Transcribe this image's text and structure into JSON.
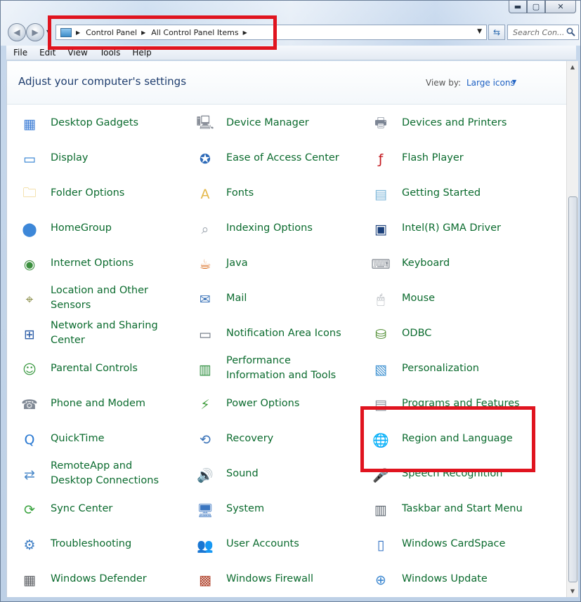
{
  "window": {
    "caption_buttons": [
      "minimize-icon",
      "maximize-icon",
      "close-icon"
    ]
  },
  "nav": {
    "address_path": [
      "Control Panel",
      "All Control Panel Items"
    ],
    "search_placeholder": "Search Con..."
  },
  "menu": [
    "File",
    "Edit",
    "View",
    "Tools",
    "Help"
  ],
  "header": {
    "title": "Adjust your computer's settings",
    "view_by_label": "View by:",
    "view_by_value": "Large icons"
  },
  "items": [
    {
      "label": "Desktop Gadgets",
      "icon": "desktop-gadgets-icon",
      "color": "#3a7bd5",
      "glyph": "▦"
    },
    {
      "label": "Device Manager",
      "icon": "device-manager-icon",
      "color": "#8a8f99",
      "glyph": "🖳"
    },
    {
      "label": "Devices and Printers",
      "icon": "devices-printers-icon",
      "color": "#7c8594",
      "glyph": "🖶"
    },
    {
      "label": "Display",
      "icon": "display-icon",
      "color": "#2f7fd1",
      "glyph": "▭"
    },
    {
      "label": "Ease of Access Center",
      "icon": "ease-of-access-icon",
      "color": "#2d6ab8",
      "glyph": "✪"
    },
    {
      "label": "Flash Player",
      "icon": "flash-player-icon",
      "color": "#c3161c",
      "glyph": "ƒ"
    },
    {
      "label": "Folder Options",
      "icon": "folder-options-icon",
      "color": "#e7c155",
      "glyph": "🗀"
    },
    {
      "label": "Fonts",
      "icon": "fonts-icon",
      "color": "#e4b84a",
      "glyph": "A"
    },
    {
      "label": "Getting Started",
      "icon": "getting-started-icon",
      "color": "#7cb6d8",
      "glyph": "▤"
    },
    {
      "label": "HomeGroup",
      "icon": "homegroup-icon",
      "color": "#3d87d8",
      "glyph": "⬤"
    },
    {
      "label": "Indexing Options",
      "icon": "indexing-options-icon",
      "color": "#9aa3ad",
      "glyph": "⌕"
    },
    {
      "label": "Intel(R) GMA Driver",
      "icon": "intel-gma-icon",
      "color": "#1a3f7a",
      "glyph": "▣"
    },
    {
      "label": "Internet Options",
      "icon": "internet-options-icon",
      "color": "#3b8f3e",
      "glyph": "◉"
    },
    {
      "label": "Java",
      "icon": "java-icon",
      "color": "#d86a1b",
      "glyph": "☕"
    },
    {
      "label": "Keyboard",
      "icon": "keyboard-icon",
      "color": "#8d939b",
      "glyph": "⌨"
    },
    {
      "label": "Location and Other Sensors",
      "icon": "location-sensors-icon",
      "color": "#8b8f4a",
      "glyph": "⌖"
    },
    {
      "label": "Mail",
      "icon": "mail-icon",
      "color": "#3a73b8",
      "glyph": "✉"
    },
    {
      "label": "Mouse",
      "icon": "mouse-icon",
      "color": "#a7acb3",
      "glyph": "🖱"
    },
    {
      "label": "Network and Sharing Center",
      "icon": "network-sharing-icon",
      "color": "#2f5fa8",
      "glyph": "⊞"
    },
    {
      "label": "Notification Area Icons",
      "icon": "notification-area-icon",
      "color": "#6b7480",
      "glyph": "▭"
    },
    {
      "label": "ODBC",
      "icon": "odbc-icon",
      "color": "#4c8b2e",
      "glyph": "⛁"
    },
    {
      "label": "Parental Controls",
      "icon": "parental-controls-icon",
      "color": "#3d9a44",
      "glyph": "☺"
    },
    {
      "label": "Performance Information and Tools",
      "icon": "performance-icon",
      "color": "#2b8d3c",
      "glyph": "▥"
    },
    {
      "label": "Personalization",
      "icon": "personalization-icon",
      "color": "#3a8fd0",
      "glyph": "▧"
    },
    {
      "label": "Phone and Modem",
      "icon": "phone-modem-icon",
      "color": "#7f8894",
      "glyph": "☎"
    },
    {
      "label": "Power Options",
      "icon": "power-options-icon",
      "color": "#3d9b3a",
      "glyph": "⚡"
    },
    {
      "label": "Programs and Features",
      "icon": "programs-features-icon",
      "color": "#8a8f99",
      "glyph": "▤"
    },
    {
      "label": "QuickTime",
      "icon": "quicktime-icon",
      "color": "#2a79d2",
      "glyph": "Q"
    },
    {
      "label": "Recovery",
      "icon": "recovery-icon",
      "color": "#3a73b8",
      "glyph": "⟲"
    },
    {
      "label": "Region and Language",
      "icon": "region-language-icon",
      "color": "#2e8fd6",
      "glyph": "🌐"
    },
    {
      "label": "RemoteApp and Desktop Connections",
      "icon": "remoteapp-icon",
      "color": "#4b89c9",
      "glyph": "⇄"
    },
    {
      "label": "Sound",
      "icon": "sound-icon",
      "color": "#9ba3ad",
      "glyph": "🔊"
    },
    {
      "label": "Speech Recognition",
      "icon": "speech-recognition-icon",
      "color": "#a8aeb6",
      "glyph": "🎤"
    },
    {
      "label": "Sync Center",
      "icon": "sync-center-icon",
      "color": "#3aa33f",
      "glyph": "⟳"
    },
    {
      "label": "System",
      "icon": "system-icon",
      "color": "#3b76c0",
      "glyph": "🖥"
    },
    {
      "label": "Taskbar and Start Menu",
      "icon": "taskbar-start-icon",
      "color": "#5d6670",
      "glyph": "▥"
    },
    {
      "label": "Troubleshooting",
      "icon": "troubleshooting-icon",
      "color": "#3d7dc4",
      "glyph": "⚙"
    },
    {
      "label": "User Accounts",
      "icon": "user-accounts-icon",
      "color": "#d09b3a",
      "glyph": "👥"
    },
    {
      "label": "Windows CardSpace",
      "icon": "windows-cardspace-icon",
      "color": "#2f6fc2",
      "glyph": "▯"
    },
    {
      "label": "Windows Defender",
      "icon": "windows-defender-icon",
      "color": "#5b5e63",
      "glyph": "▦"
    },
    {
      "label": "Windows Firewall",
      "icon": "windows-firewall-icon",
      "color": "#b0432c",
      "glyph": "▩"
    },
    {
      "label": "Windows Update",
      "icon": "windows-update-icon",
      "color": "#3a86d0",
      "glyph": "⊕"
    }
  ]
}
